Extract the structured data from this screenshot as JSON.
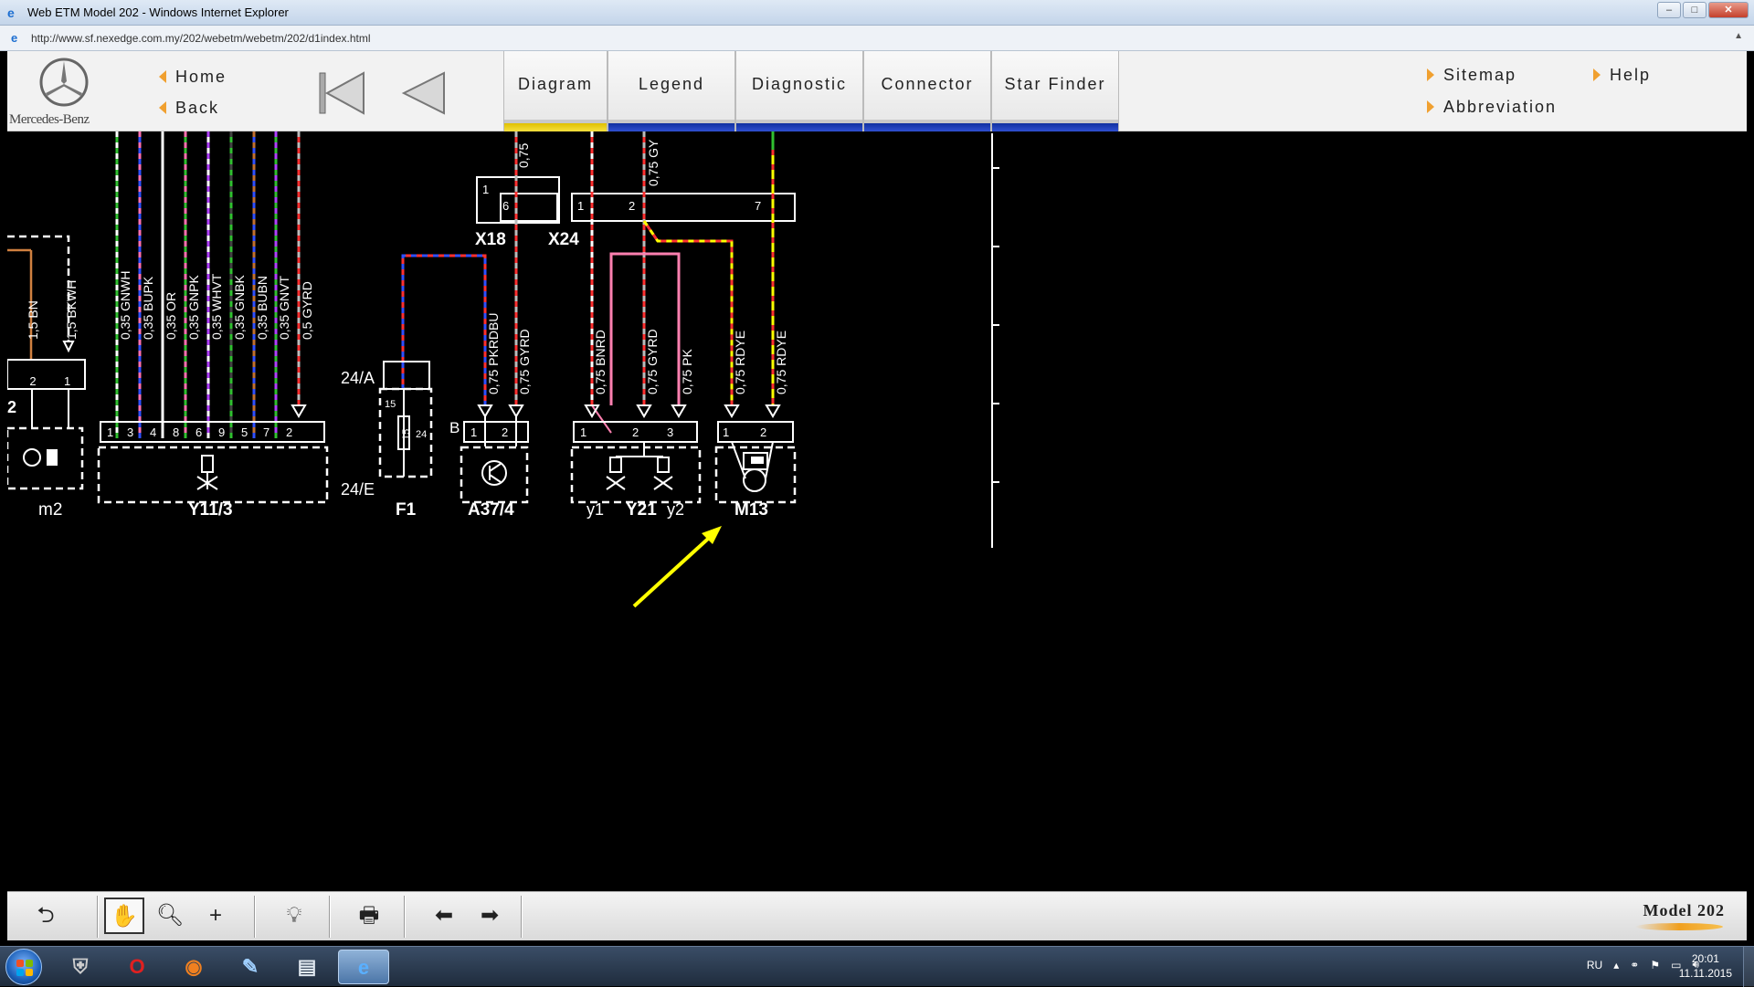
{
  "window": {
    "title": "Web ETM Model 202 - Windows Internet Explorer",
    "url": "http://www.sf.nexedge.com.my/202/webetm/webetm/202/d1index.html"
  },
  "header": {
    "brand": "Mercedes-Benz",
    "nav": {
      "home": "Home",
      "back": "Back",
      "sitemap": "Sitemap",
      "help": "Help",
      "abbreviation": "Abbreviation"
    },
    "tabs": [
      {
        "label": "Diagram",
        "active": true
      },
      {
        "label": "Legend",
        "active": false
      },
      {
        "label": "Diagnostic",
        "active": false
      },
      {
        "label": "Connector",
        "active": false
      },
      {
        "label": "Star Finder",
        "active": false
      }
    ]
  },
  "diagram": {
    "components": {
      "m2": "m2",
      "y11_3": "Y11/3",
      "f1": "F1",
      "a37_4": "A37/4",
      "y1": "y1",
      "y21": "Y21",
      "y2": "y2",
      "m13": "M13",
      "x18": "X18",
      "x24": "X24",
      "f1_a": "24/A",
      "f1_e": "24/E",
      "b": "B"
    },
    "wire_labels": {
      "bn": "1,5 BN",
      "bkwh": "1,5 BKWH",
      "gnwh": "0,35 GNWH",
      "bupk": "0,35 BUPK",
      "or": "0,35 OR",
      "gnpk": "0,35 GNPK",
      "whvt": "0,35 WHVT",
      "gnbk": "0,35 GNBK",
      "bubn": "0,35 BUBN",
      "gnvt": "0,35 GNVT",
      "gyrd05": "0,5 GYRD",
      "x18_top": "0,75",
      "x24_top": "0,75 GY",
      "pkrdbu": "0,75 PKRDBU",
      "gyrd075a": "0,75 GYRD",
      "bnrd": "0,75 BNRD",
      "gyrd075b": "0,75 GYRD",
      "pk": "0,75 PK",
      "rdye1": "0,75 RDYE",
      "rdye2": "0,75 RDYE"
    },
    "pins": {
      "m2": [
        "2",
        "1",
        "2"
      ],
      "y11": [
        "1",
        "3",
        "4",
        "8",
        "6",
        "9",
        "5",
        "7",
        "2"
      ],
      "x18": [
        "1",
        "6"
      ],
      "x24": [
        "1",
        "2",
        "7"
      ],
      "f1": [
        "15",
        "15",
        "24"
      ],
      "a37": [
        "1",
        "2"
      ],
      "y21": [
        "1",
        "2",
        "3"
      ],
      "m13": [
        "1",
        "2"
      ]
    },
    "annotation_color": "#ffff00"
  },
  "toolbar": {
    "model": "Model 202",
    "buttons": [
      "restore-icon",
      "pan-hand-icon",
      "zoom-icon",
      "crosshair-icon",
      "lightbulb-icon",
      "print-icon",
      "arrow-left-icon",
      "arrow-right-icon"
    ]
  },
  "taskbar": {
    "language": "RU",
    "time": "20:01",
    "date": "11.11.2015"
  }
}
